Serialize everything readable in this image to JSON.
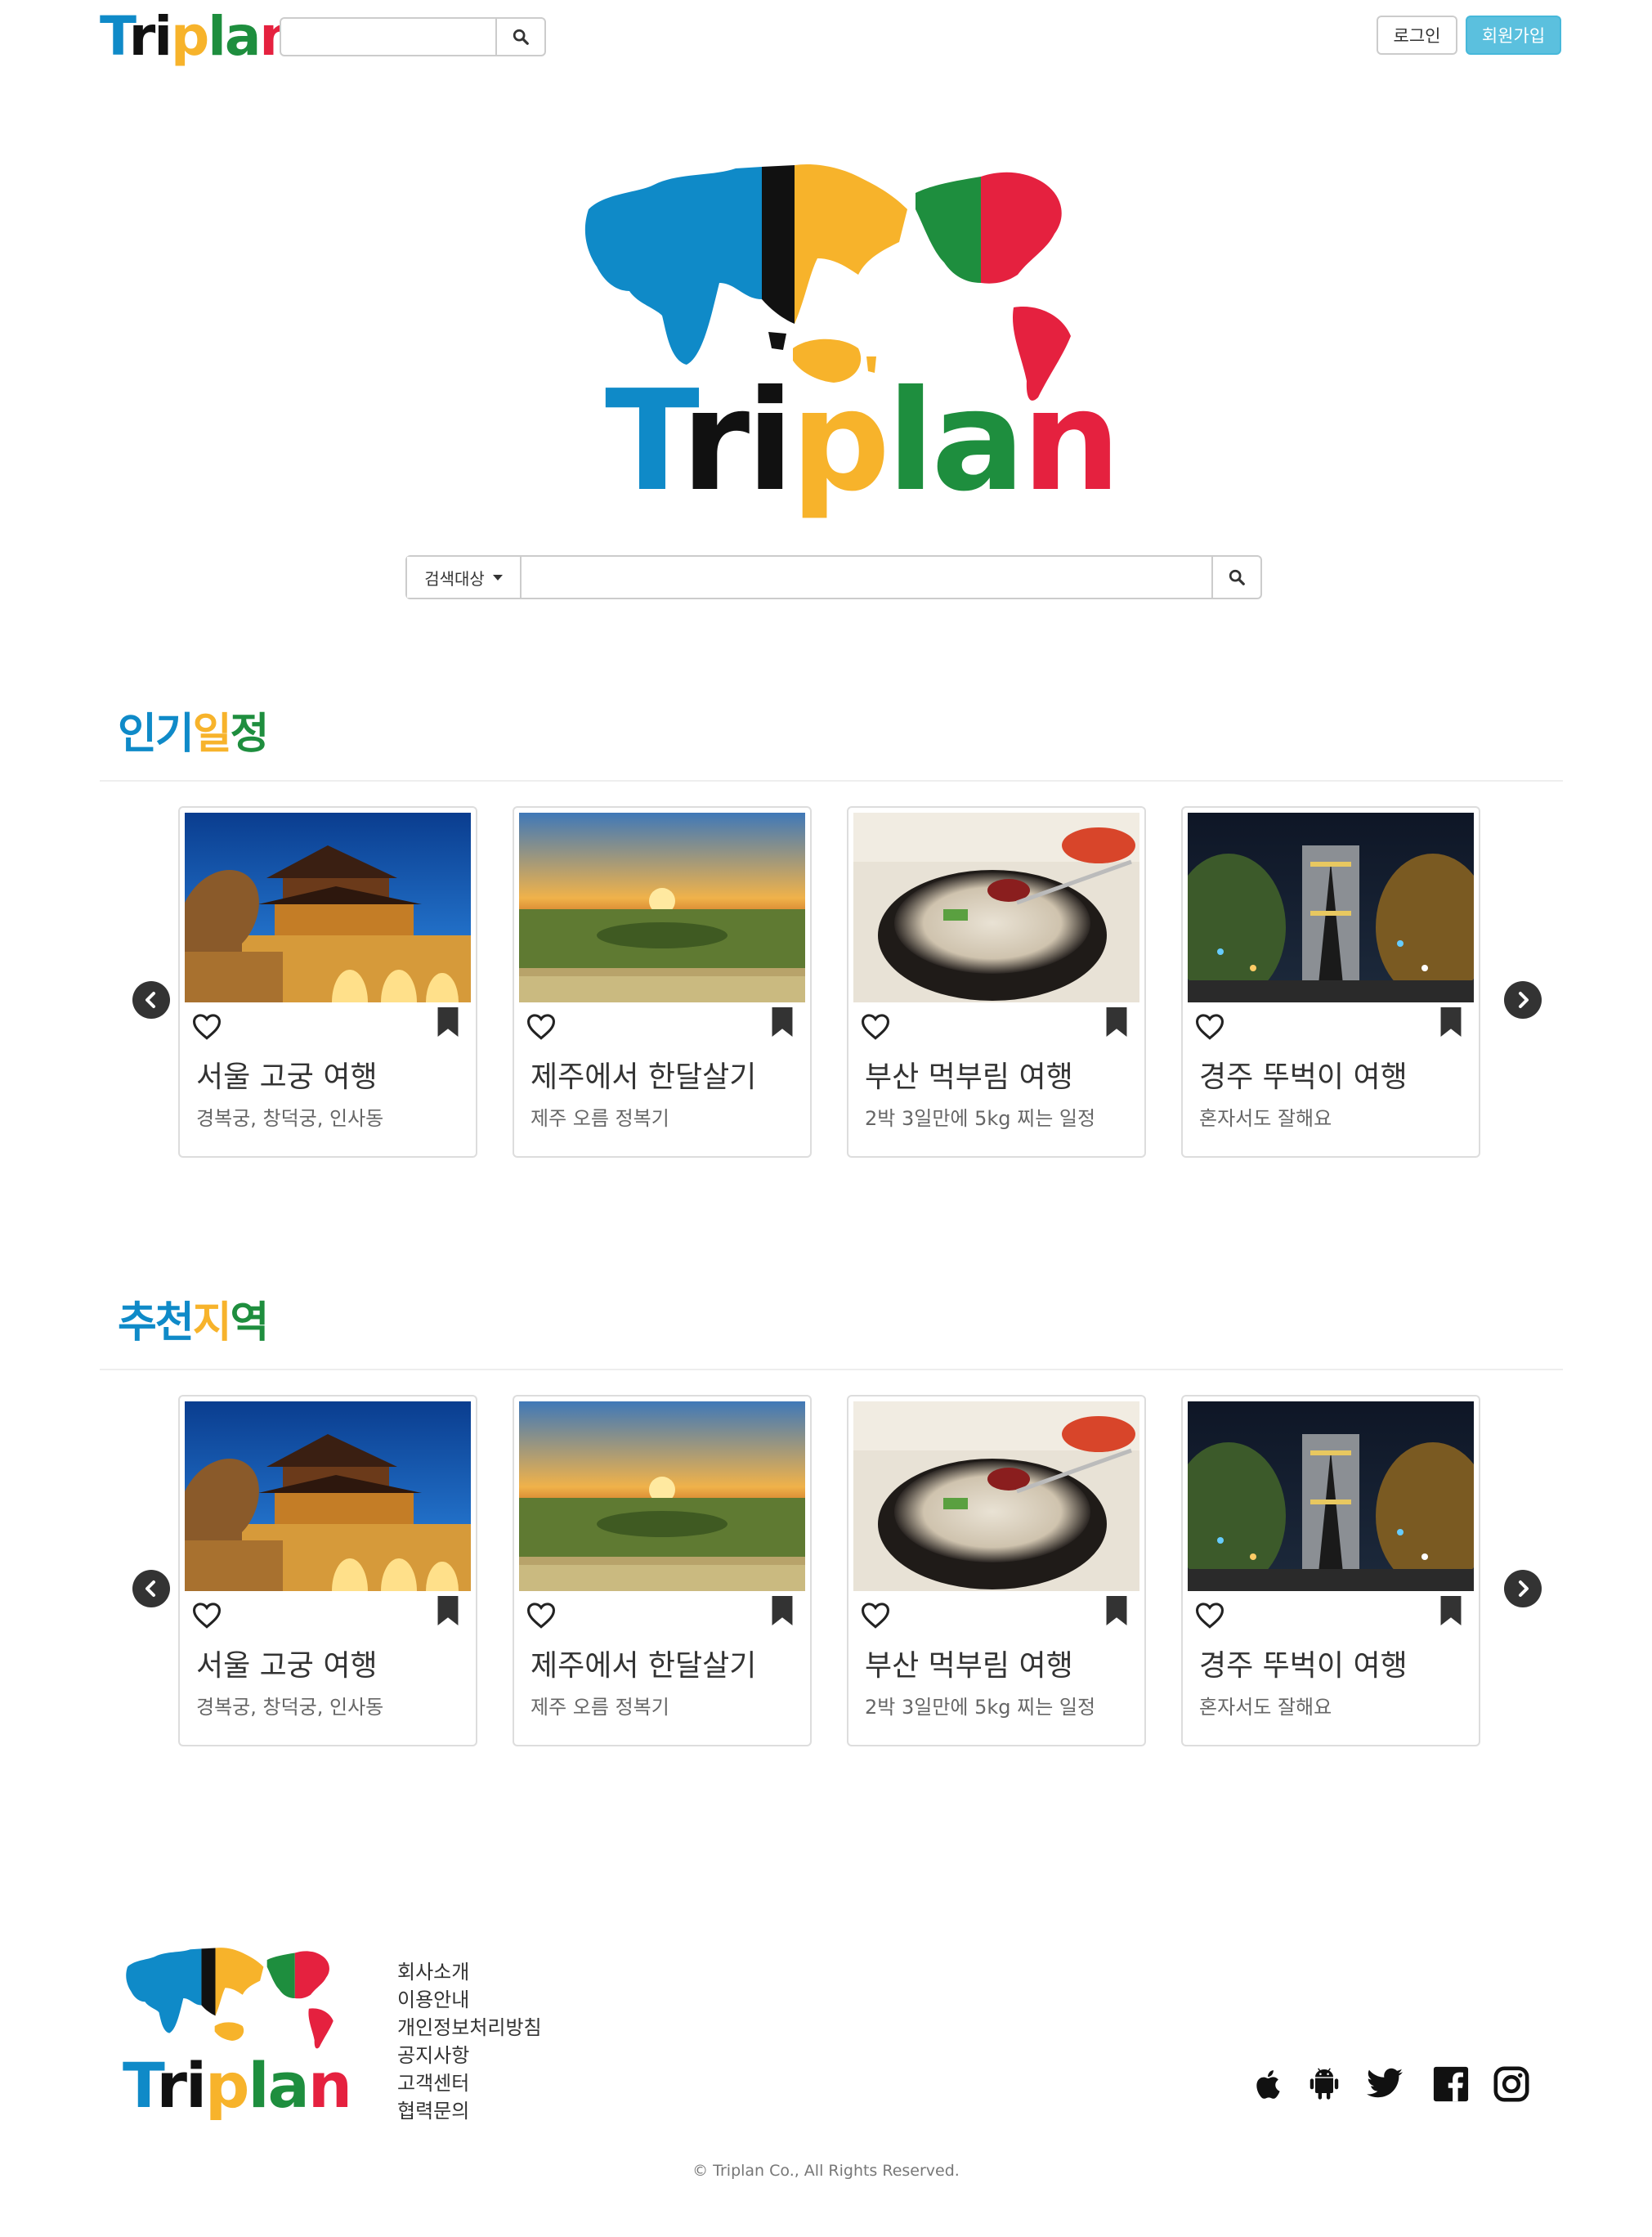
{
  "header": {
    "logo_text": "Triplan",
    "search_placeholder": "",
    "login_label": "로그인",
    "signup_label": "회원가입"
  },
  "hero": {
    "logo_text": "Triplan",
    "search": {
      "dropdown_label": "검색대상",
      "placeholder": ""
    }
  },
  "sections": [
    {
      "title_parts": [
        "인기",
        "일",
        "정"
      ],
      "cards": [
        {
          "title": "서울 고궁 여행",
          "subtitle": "경복궁, 창덕궁, 인사동",
          "image": "palace-night"
        },
        {
          "title": "제주에서 한달살기",
          "subtitle": "제주 오름 정복기",
          "image": "jeju-sunset"
        },
        {
          "title": "부산 먹부림 여행",
          "subtitle": "2박 3일만에 5kg 찌는 일정",
          "image": "gukbap-soup"
        },
        {
          "title": "경주 뚜벅이 여행",
          "subtitle": "혼자서도 잘해요",
          "image": "gyeongju-tower"
        }
      ]
    },
    {
      "title_parts": [
        "추천",
        "지",
        "역"
      ],
      "cards": [
        {
          "title": "서울 고궁 여행",
          "subtitle": "경복궁, 창덕궁, 인사동",
          "image": "palace-night"
        },
        {
          "title": "제주에서 한달살기",
          "subtitle": "제주 오름 정복기",
          "image": "jeju-sunset"
        },
        {
          "title": "부산 먹부림 여행",
          "subtitle": "2박 3일만에 5kg 찌는 일정",
          "image": "gukbap-soup"
        },
        {
          "title": "경주 뚜벅이 여행",
          "subtitle": "혼자서도 잘해요",
          "image": "gyeongju-tower"
        }
      ]
    }
  ],
  "footer": {
    "logo_text": "Triplan",
    "links": [
      "회사소개",
      "이용안내",
      "개인정보처리방침",
      "공지사항",
      "고객센터",
      "협력문의"
    ],
    "social_icons": [
      "apple-icon",
      "android-icon",
      "twitter-icon",
      "facebook-icon",
      "instagram-icon"
    ],
    "copyright": "© Triplan Co., All Rights Reserved."
  },
  "colors": {
    "blue": "#0f8ac8",
    "black": "#111111",
    "yellow": "#f7b32b",
    "green": "#1e8e3e",
    "red": "#e5213f",
    "signup_bg": "#5bc0de"
  }
}
